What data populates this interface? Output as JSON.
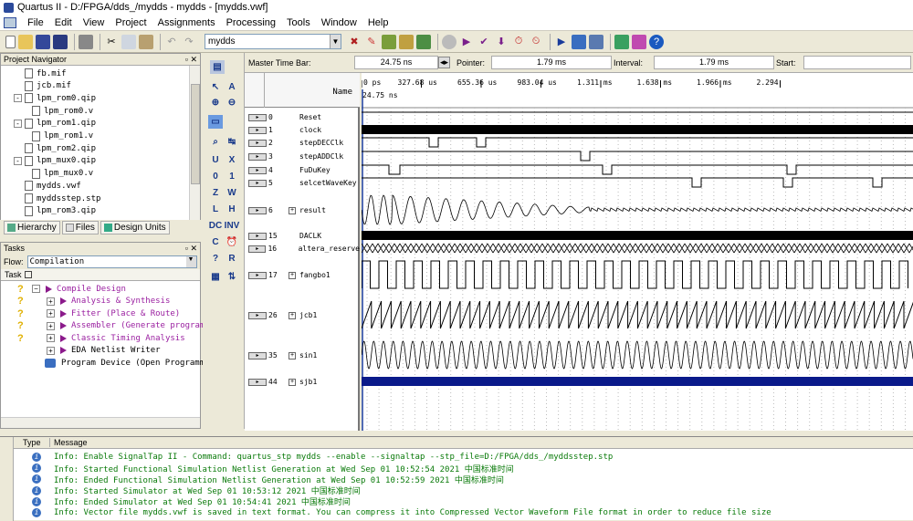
{
  "window": {
    "title": "Quartus II - D:/FPGA/dds_/mydds - mydds - [mydds.vwf]"
  },
  "menu": [
    "File",
    "Edit",
    "View",
    "Project",
    "Assignments",
    "Processing",
    "Tools",
    "Window",
    "Help"
  ],
  "toolbar": {
    "entity": "mydds"
  },
  "project_navigator": {
    "title": "Project Navigator",
    "items": [
      {
        "label": "fb.mif",
        "indent": 1,
        "expand": ""
      },
      {
        "label": "jcb.mif",
        "indent": 1,
        "expand": ""
      },
      {
        "label": "lpm_rom0.qip",
        "indent": 1,
        "expand": "-"
      },
      {
        "label": "lpm_rom0.v",
        "indent": 2,
        "expand": ""
      },
      {
        "label": "lpm_rom1.qip",
        "indent": 1,
        "expand": "-"
      },
      {
        "label": "lpm_rom1.v",
        "indent": 2,
        "expand": ""
      },
      {
        "label": "lpm_rom2.qip",
        "indent": 1,
        "expand": ""
      },
      {
        "label": "lpm_mux0.qip",
        "indent": 1,
        "expand": "-"
      },
      {
        "label": "lpm_mux0.v",
        "indent": 2,
        "expand": ""
      },
      {
        "label": "mydds.vwf",
        "indent": 1,
        "expand": ""
      },
      {
        "label": "myddsstep.stp",
        "indent": 1,
        "expand": ""
      },
      {
        "label": "lpm_rom3.qip",
        "indent": 1,
        "expand": ""
      }
    ],
    "tabs": [
      "Hierarchy",
      "Files",
      "Design Units"
    ]
  },
  "tasks": {
    "title": "Tasks",
    "flow_label": "Flow:",
    "flow_value": "Compilation",
    "task_header": "Task",
    "items": [
      {
        "label": "Compile Design",
        "level": 0,
        "status": "?"
      },
      {
        "label": "Analysis & Synthesis",
        "level": 1,
        "status": "?"
      },
      {
        "label": "Fitter (Place & Route)",
        "level": 1,
        "status": "?"
      },
      {
        "label": "Assembler (Generate programmi",
        "level": 1,
        "status": "?"
      },
      {
        "label": "Classic Timing Analysis",
        "level": 1,
        "status": "?"
      },
      {
        "label": "EDA Netlist Writer",
        "level": 1,
        "status": ""
      },
      {
        "label": "Program Device (Open Programmer)",
        "level": 0,
        "status": ""
      }
    ]
  },
  "waveform": {
    "master_time_bar_label": "Master Time Bar:",
    "master_time_bar": "24.75 ns",
    "pointer_label": "Pointer:",
    "pointer": "1.79 ms",
    "interval_label": "Interval:",
    "interval": "1.79 ms",
    "start_label": "Start:",
    "name_header": "Name",
    "cursor_time": "24.75 ns",
    "ruler": [
      "0 ps",
      "327.68 us",
      "655.36 us",
      "983.04 us",
      "1.311 ms",
      "1.638 ms",
      "1.966 ms",
      "2.294"
    ],
    "signals": [
      {
        "index": "0",
        "name": "Reset",
        "expand": false
      },
      {
        "index": "1",
        "name": "clock",
        "expand": false
      },
      {
        "index": "2",
        "name": "stepDECClk",
        "expand": false
      },
      {
        "index": "3",
        "name": "stepADDClk",
        "expand": false
      },
      {
        "index": "4",
        "name": "FuDuKey",
        "expand": false
      },
      {
        "index": "5",
        "name": "selcetWaveKey",
        "expand": false
      },
      {
        "index": "6",
        "name": "result",
        "expand": true
      },
      {
        "index": "15",
        "name": "DACLK",
        "expand": false
      },
      {
        "index": "16",
        "name": "altera_reserve",
        "expand": false
      },
      {
        "index": "17",
        "name": "fangbo1",
        "expand": true
      },
      {
        "index": "26",
        "name": "jcb1",
        "expand": true
      },
      {
        "index": "35",
        "name": "sin1",
        "expand": true
      },
      {
        "index": "44",
        "name": "sjb1",
        "expand": true
      }
    ]
  },
  "messages": {
    "type_header": "Type",
    "message_header": "Message",
    "rows": [
      "Info: Enable SignalTap II - Command: quartus_stp mydds --enable --signaltap --stp_file=D:/FPGA/dds_/myddsstep.stp",
      "Info: Started Functional Simulation Netlist Generation at Wed Sep 01 10:52:54 2021 中国标准时间",
      "Info: Ended Functional Simulation Netlist Generation at Wed Sep 01 10:52:59 2021 中国标准时间",
      "Info: Started Simulator at Wed Sep 01 10:53:12 2021 中国标准时间",
      "Info: Ended Simulator at Wed Sep 01 10:54:41 2021 中国标准时间",
      "Info: Vector file mydds.vwf is saved in text format. You can compress it into Compressed Vector Waveform File format in order to reduce file size"
    ]
  },
  "colors": {
    "accent": "#2b4a9b",
    "wave": "#000000",
    "bus": "#0a1a8a",
    "info": "#0a7a0a"
  }
}
